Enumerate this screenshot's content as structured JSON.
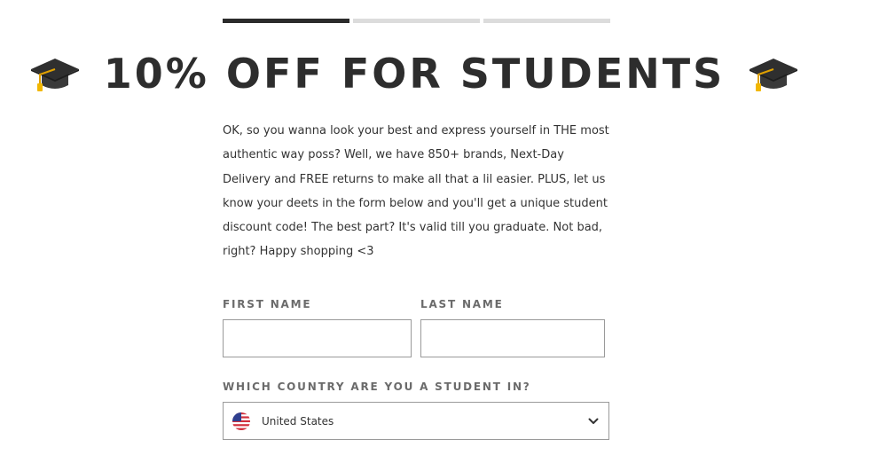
{
  "progress": {
    "steps_total": 3,
    "active_step": 1
  },
  "heading": {
    "title": "10% OFF FOR STUDENTS",
    "icon": "graduation-cap-icon"
  },
  "intro": {
    "text": "OK, so you wanna look your best and express yourself in THE most authentic way poss? Well, we have 850+ brands, Next-Day Delivery and FREE returns to make all that a lil easier. PLUS, let us know your deets in the form below and you'll get a unique student discount code! The best part? It's valid till you graduate. Not bad, right? Happy shopping <3"
  },
  "form": {
    "first_name": {
      "label": "FIRST NAME",
      "value": "",
      "placeholder": ""
    },
    "last_name": {
      "label": "LAST NAME",
      "value": "",
      "placeholder": ""
    },
    "country": {
      "label": "WHICH COUNTRY ARE YOU A STUDENT IN?",
      "selected": "United States",
      "flag_icon": "us-flag-icon",
      "chevron_icon": "chevron-down-icon"
    }
  },
  "colors": {
    "progress_active": "#2b2b2b",
    "progress_inactive": "#dcdcdc",
    "heading": "#2d2d2d",
    "label": "#6b6b6b",
    "border": "#9a9a9a"
  }
}
